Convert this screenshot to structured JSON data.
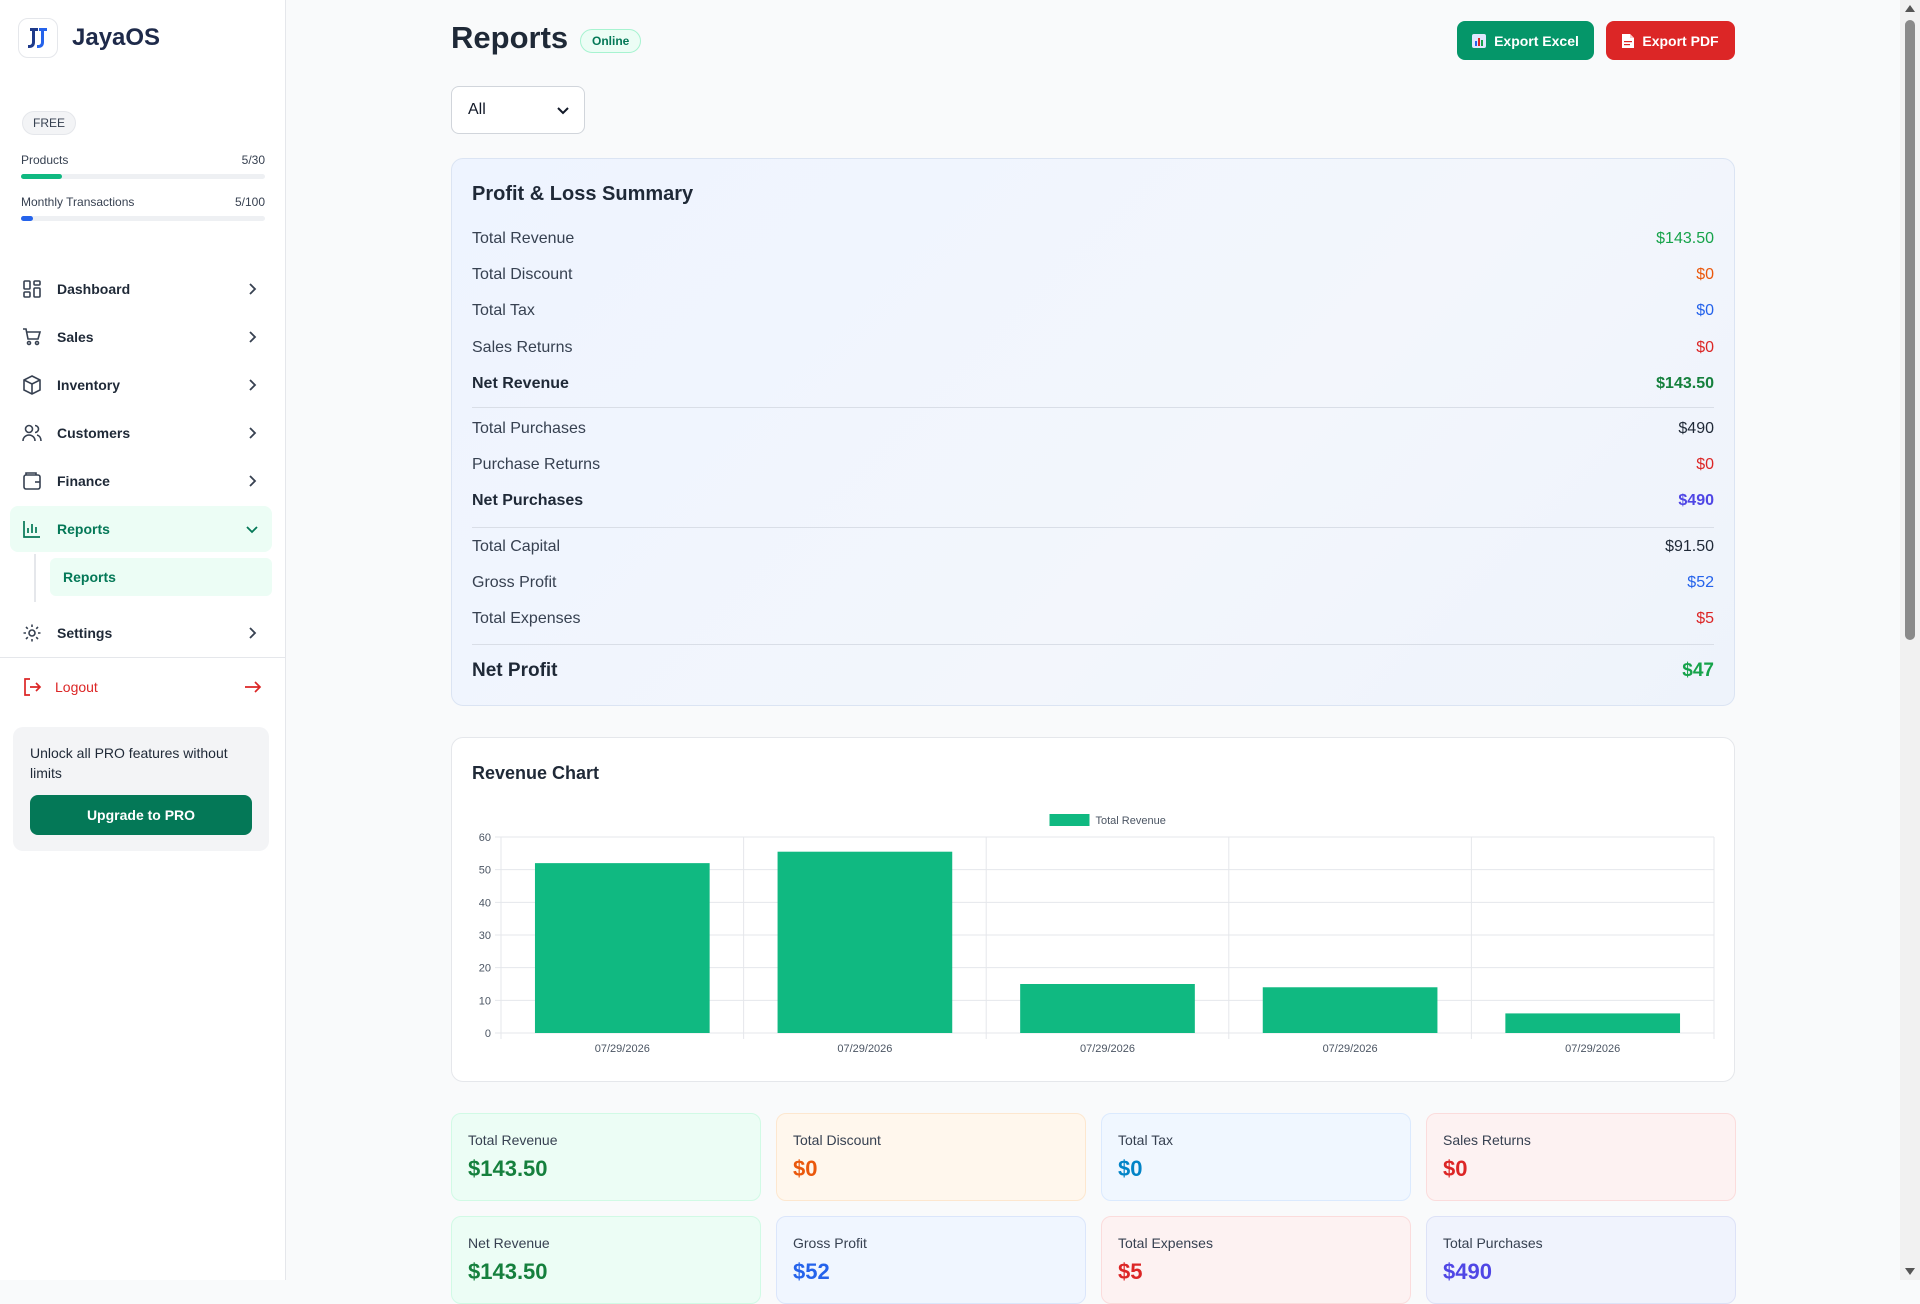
{
  "app": {
    "name": "JayaOS"
  },
  "plan": {
    "badge": "FREE",
    "usage": [
      {
        "label": "Products",
        "value": "5/30",
        "fraction": 0.167,
        "color": "#10b981"
      },
      {
        "label": "Monthly Transactions",
        "value": "5/100",
        "fraction": 0.05,
        "color": "#2563eb"
      }
    ]
  },
  "sidebar": {
    "items": [
      {
        "label": "Dashboard",
        "icon": "dashboard-icon"
      },
      {
        "label": "Sales",
        "icon": "cart-icon"
      },
      {
        "label": "Inventory",
        "icon": "box-icon"
      },
      {
        "label": "Customers",
        "icon": "users-icon"
      },
      {
        "label": "Finance",
        "icon": "wallet-icon"
      },
      {
        "label": "Reports",
        "icon": "bar-chart-icon",
        "active": true,
        "sub": [
          "Reports"
        ]
      },
      {
        "label": "Settings",
        "icon": "gear-icon"
      }
    ],
    "logout": "Logout",
    "promo": {
      "text": "Unlock all PRO features without limits",
      "button": "Upgrade to PRO"
    }
  },
  "header": {
    "title": "Reports",
    "status": "Online",
    "export_excel": "Export Excel",
    "export_pdf": "Export PDF"
  },
  "filter": {
    "value": "All"
  },
  "summary": {
    "title": "Profit & Loss Summary",
    "rows": [
      {
        "label": "Total Revenue",
        "value": "$143.50",
        "color": "#16a34a"
      },
      {
        "label": "Total Discount",
        "value": "$0",
        "color": "#ea580c"
      },
      {
        "label": "Total Tax",
        "value": "$0",
        "color": "#2563eb"
      },
      {
        "label": "Sales Returns",
        "value": "$0",
        "color": "#dc2626"
      },
      {
        "label": "Net Revenue",
        "value": "$143.50",
        "color": "#15803d",
        "bold": true
      },
      {
        "label": "Total Purchases",
        "value": "$490",
        "color": "#1f2937"
      },
      {
        "label": "Purchase Returns",
        "value": "$0",
        "color": "#dc2626"
      },
      {
        "label": "Net Purchases",
        "value": "$490",
        "color": "#4f46e5",
        "bold": true
      },
      {
        "label": "Total Capital",
        "value": "$91.50",
        "color": "#1f2937"
      },
      {
        "label": "Gross Profit",
        "value": "$52",
        "color": "#2563eb"
      },
      {
        "label": "Total Expenses",
        "value": "$5",
        "color": "#dc2626"
      },
      {
        "label": "Net Profit",
        "value": "$47",
        "color": "#16a34a",
        "big": true
      }
    ]
  },
  "chart": {
    "title": "Revenue Chart"
  },
  "chart_data": {
    "type": "bar",
    "categories": [
      "07/29/2026",
      "07/29/2026",
      "07/29/2026",
      "07/29/2026",
      "07/29/2026"
    ],
    "series": [
      {
        "name": "Total Revenue",
        "values": [
          52,
          55.5,
          15,
          14,
          6
        ],
        "color": "#10b981"
      }
    ],
    "ylim": [
      0,
      60
    ],
    "yticks": [
      0,
      10,
      20,
      30,
      40,
      50,
      60
    ],
    "legend": "top-center",
    "grid": true
  },
  "kpis": [
    {
      "label": "Total Revenue",
      "value": "$143.50",
      "color": "#15803d",
      "bg": "#ecfdf5",
      "border": "#d1fae5"
    },
    {
      "label": "Total Discount",
      "value": "$0",
      "color": "#ea580c",
      "bg": "#fff7ed",
      "border": "#fde7cf"
    },
    {
      "label": "Total Tax",
      "value": "$0",
      "color": "#0284c7",
      "bg": "#f0f7ff",
      "border": "#dbeafe"
    },
    {
      "label": "Sales Returns",
      "value": "$0",
      "color": "#dc2626",
      "bg": "#fdf2f2",
      "border": "#fbdcdc"
    },
    {
      "label": "Net Revenue",
      "value": "$143.50",
      "color": "#15803d",
      "bg": "#ecfdf5",
      "border": "#d1fae5"
    },
    {
      "label": "Gross Profit",
      "value": "$52",
      "color": "#2563eb",
      "bg": "#f0f6ff",
      "border": "#dbe6fb"
    },
    {
      "label": "Total Expenses",
      "value": "$5",
      "color": "#dc2626",
      "bg": "#fdf2f2",
      "border": "#fbdcdc"
    },
    {
      "label": "Total Purchases",
      "value": "$490",
      "color": "#4f46e5",
      "bg": "#f0f3fd",
      "border": "#dde2f7"
    }
  ]
}
